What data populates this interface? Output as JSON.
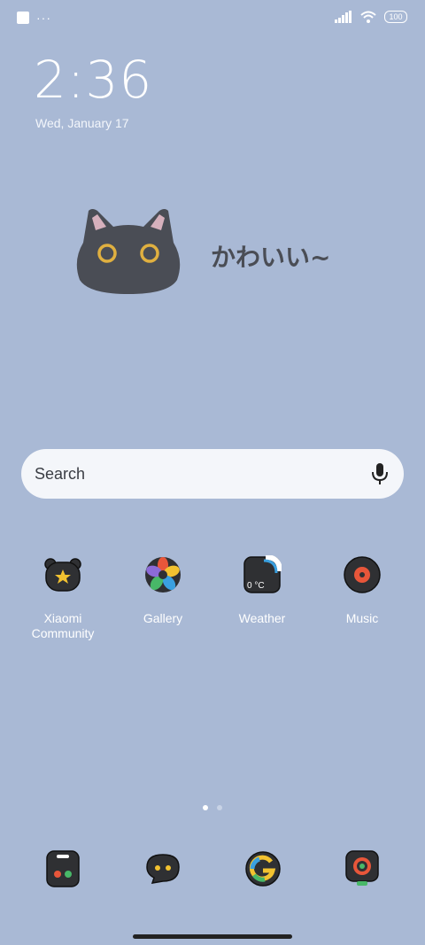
{
  "status_bar": {
    "notification_dots": "···",
    "battery": "100"
  },
  "clock": {
    "time": "2:36",
    "date": "Wed, January 17"
  },
  "widget": {
    "caption": "かわいい~"
  },
  "search": {
    "placeholder": "Search"
  },
  "apps": [
    {
      "label": "Xiaomi Community",
      "icon": "bear-icon"
    },
    {
      "label": "Gallery",
      "icon": "flower-icon"
    },
    {
      "label": "Weather",
      "icon": "weather-icon",
      "temp": "0 °C"
    },
    {
      "label": "Music",
      "icon": "vinyl-icon"
    }
  ],
  "page_indicator": {
    "pages": 2,
    "active": 1
  },
  "dock": [
    {
      "icon": "phone-icon"
    },
    {
      "icon": "messages-icon"
    },
    {
      "icon": "google-icon"
    },
    {
      "icon": "camera-icon"
    }
  ],
  "colors": {
    "wallpaper": "#a9b9d5",
    "icon_body": "#2f3033",
    "cat_body": "#4a4d55",
    "cat_eye": "#e0b040"
  }
}
